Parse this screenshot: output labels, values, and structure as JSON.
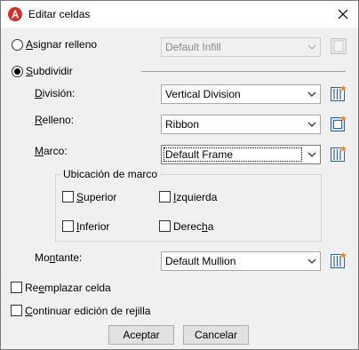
{
  "window": {
    "title": "Editar celdas"
  },
  "assign_fill": {
    "label_first": "A",
    "label_rest": "signar relleno",
    "value": "Default Infill"
  },
  "subdivide": {
    "label_first": "S",
    "label_rest": "ubdividir"
  },
  "division": {
    "label_first": "D",
    "label_rest": "ivisión:",
    "value": "Vertical Division"
  },
  "fill": {
    "label_first": "R",
    "label_rest": "elleno:",
    "value": "Ribbon"
  },
  "frame": {
    "label_first": "M",
    "label_rest": "arco:",
    "value": "Default Frame"
  },
  "frame_location": {
    "title": "Ubicación de marco",
    "top": {
      "label_first": "S",
      "label_rest": "uperior"
    },
    "left": {
      "label_first": "I",
      "label_rest": "zquierda"
    },
    "bottom": {
      "label_first": "I",
      "label_rest": "nferior"
    },
    "right": {
      "label_pre": "Derec",
      "label_u": "h",
      "label_post": "a"
    }
  },
  "mullion": {
    "label_pre": "Mo",
    "label_u": "n",
    "label_post": "tante:",
    "value": "Default Mullion"
  },
  "replace_cell": {
    "label_pre": "Re",
    "label_u": "e",
    "label_post": "mplazar celda"
  },
  "continue_edit": {
    "label_first": "C",
    "label_rest": "ontinuar edición de rejilla"
  },
  "buttons": {
    "ok": "Aceptar",
    "cancel": "Cancelar"
  },
  "colors": {
    "accent": "#d0312d",
    "icon_blue": "#2a5fae",
    "icon_orange": "#f08a1c"
  }
}
